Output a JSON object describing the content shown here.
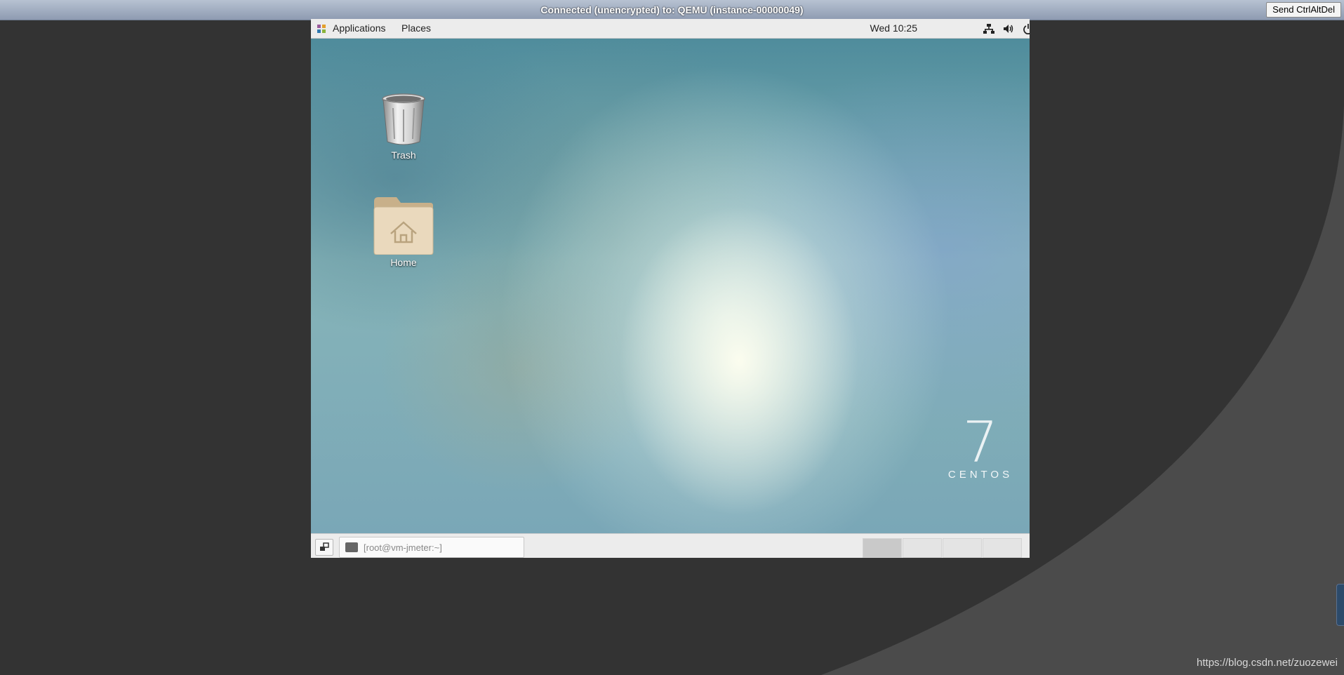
{
  "vnc": {
    "title": "Connected (unencrypted) to: QEMU (instance-00000049)",
    "send_button": "Send CtrlAltDel"
  },
  "top_panel": {
    "applications": "Applications",
    "places": "Places",
    "clock": "Wed 10:25",
    "tray_icons": [
      "network-icon",
      "volume-icon",
      "power-icon"
    ]
  },
  "desktop": {
    "icons": [
      {
        "label": "Trash",
        "icon": "trash-icon"
      },
      {
        "label": "Home",
        "icon": "home-folder-icon"
      }
    ],
    "logo_number": "7",
    "logo_text": "CENTOS"
  },
  "bottom_panel": {
    "task_label": "[root@vm-jmeter:~]",
    "workspaces": 4,
    "active_workspace": 1
  },
  "watermark": "https://blog.csdn.net/zuozewei",
  "colors": {
    "page_bg": "#333333",
    "curve": "#4b4b4b",
    "vnc_bar": "#a6b2c4",
    "panel": "#ececec"
  }
}
